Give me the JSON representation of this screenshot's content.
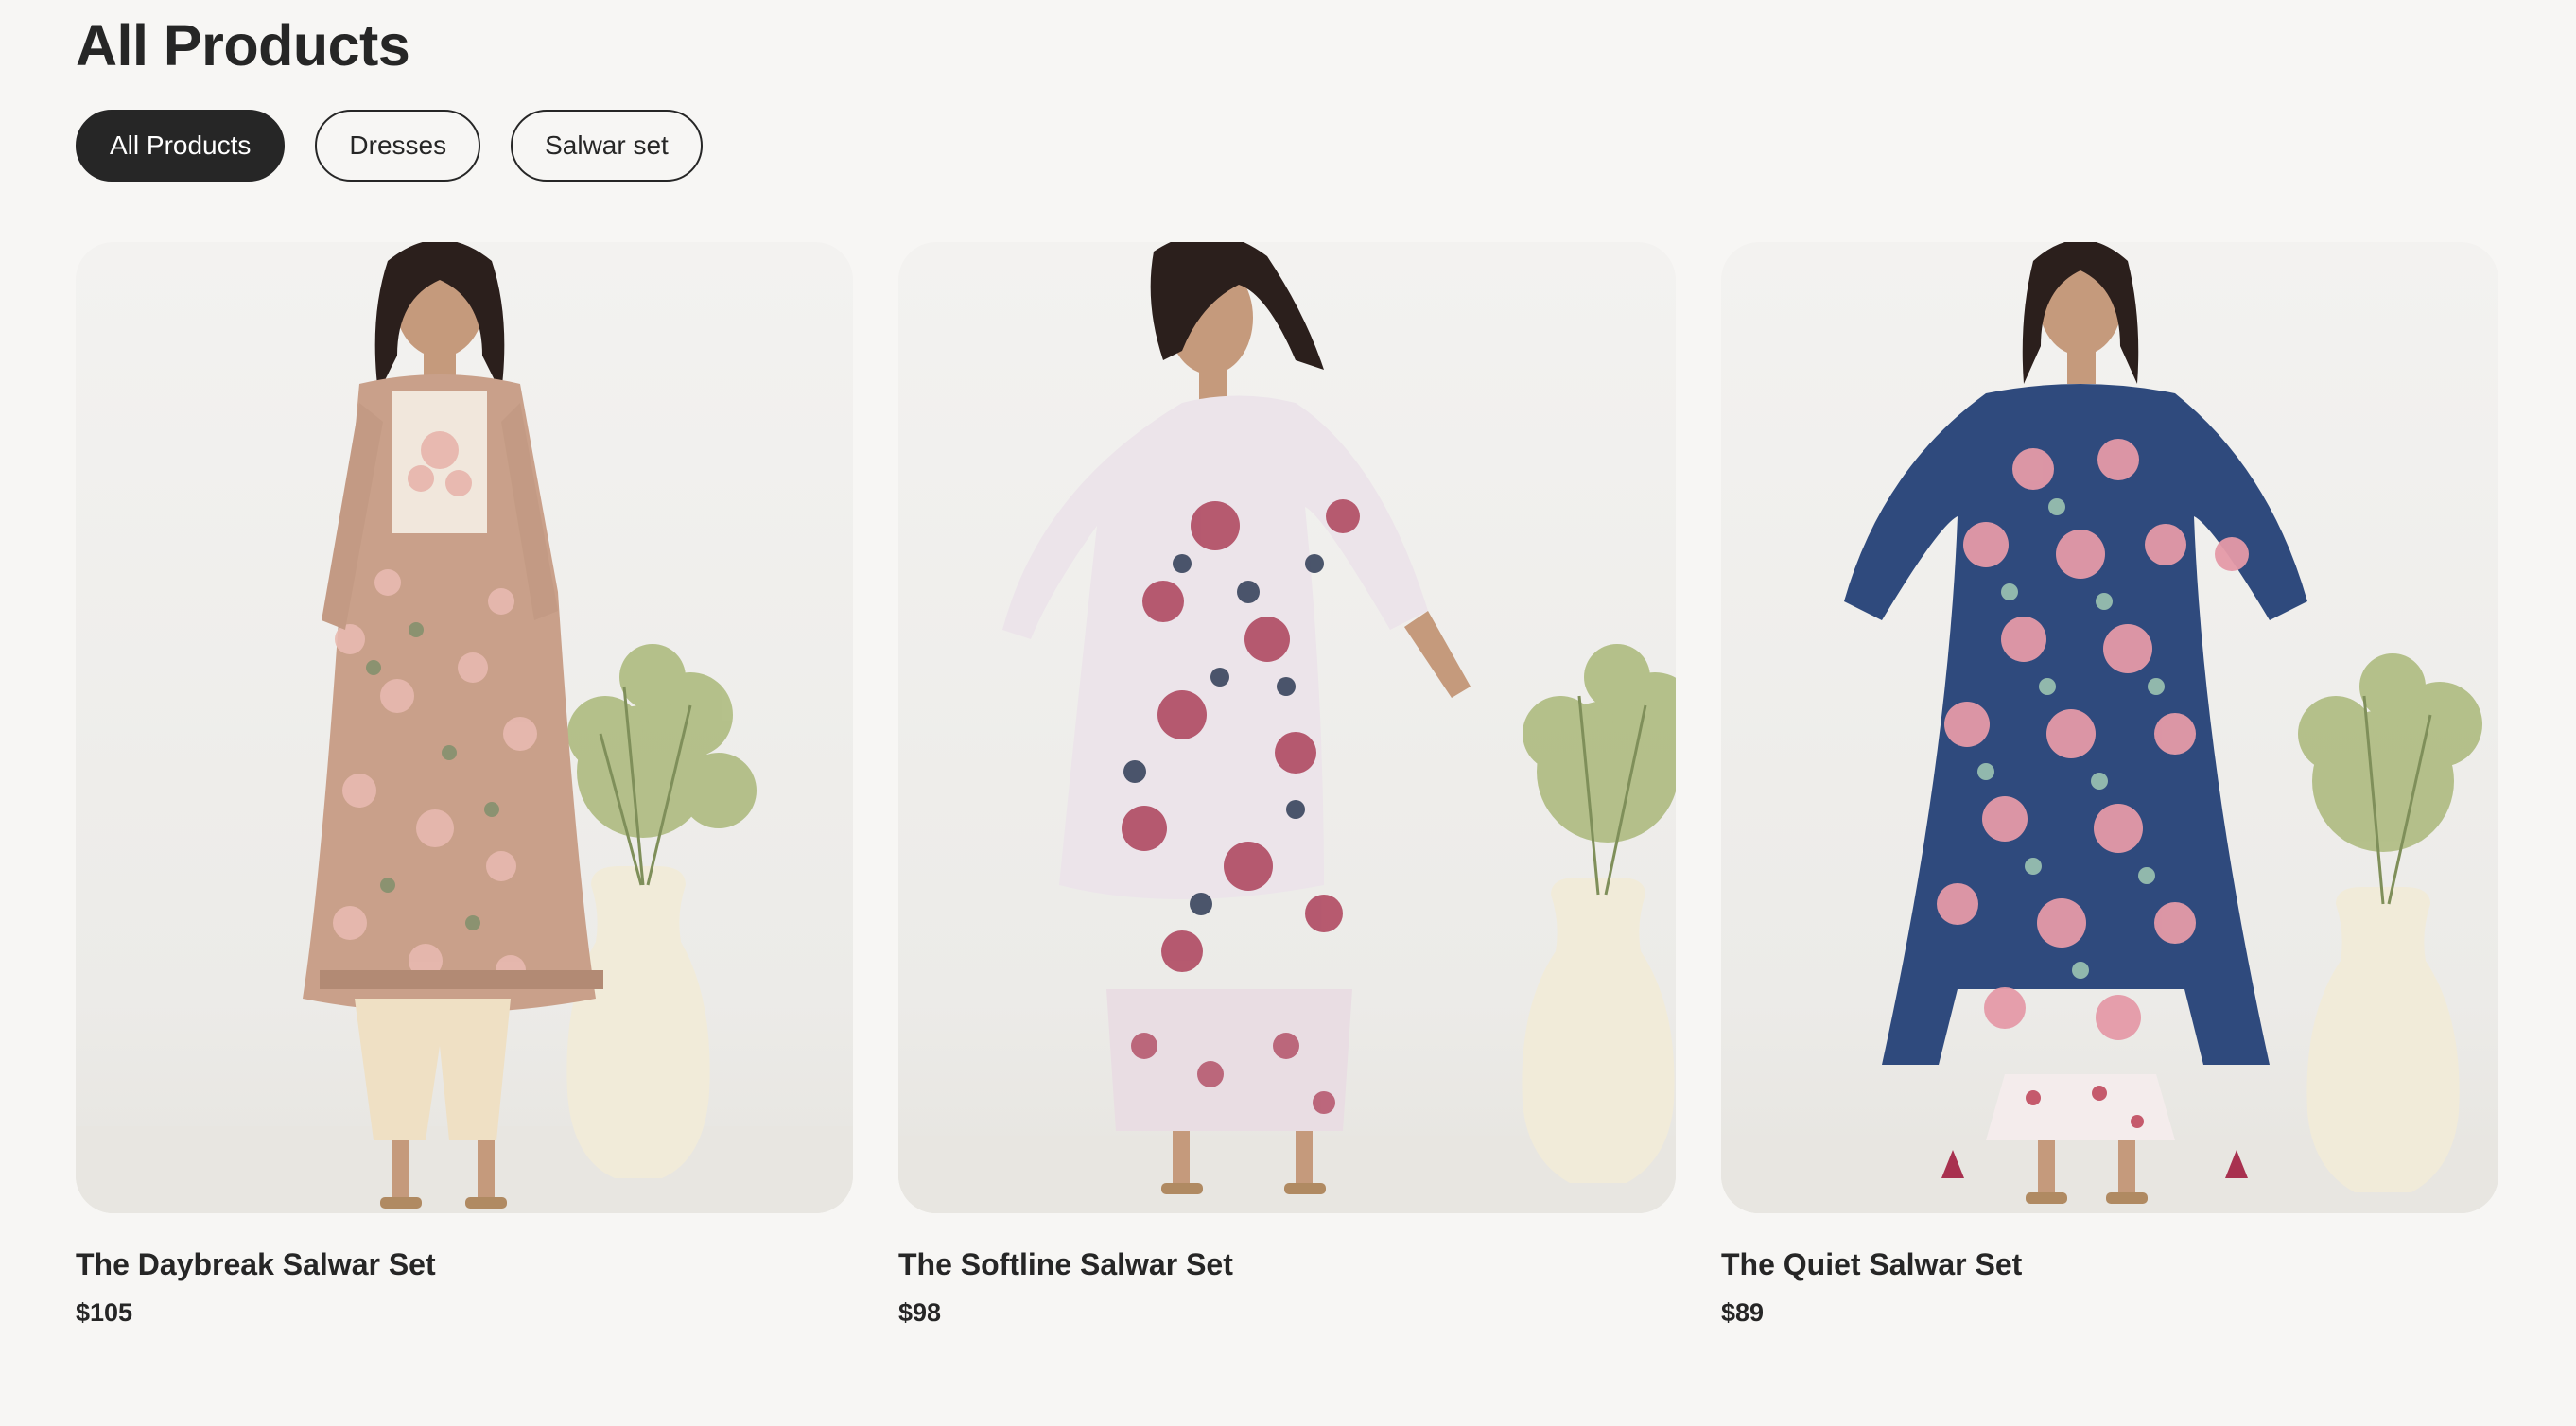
{
  "page": {
    "title": "All Products"
  },
  "filters": [
    {
      "label": "All Products",
      "active": true
    },
    {
      "label": "Dresses",
      "active": false
    },
    {
      "label": "Salwar set",
      "active": false
    }
  ],
  "products": [
    {
      "name": "The Daybreak Salwar Set",
      "price": "$105",
      "image": "photo-model-peach-floral-kurta",
      "colors": {
        "garment": "#c9a08a",
        "print": "#e8b9b0",
        "leaf": "#7c8f6a",
        "pants": "#efe0c4"
      }
    },
    {
      "name": "The Softline Salwar Set",
      "price": "$98",
      "image": "photo-model-white-kaftan-red-floral",
      "colors": {
        "garment": "#ece4ea",
        "print": "#b04a62",
        "leaf": "#2e3b55",
        "pants": "#e9dde3"
      }
    },
    {
      "name": "The Quiet Salwar Set",
      "price": "$89",
      "image": "photo-model-navy-kaftan-pink-roses",
      "colors": {
        "garment": "#2f4a7d",
        "print": "#e59aa8",
        "leaf": "#9cc4b2",
        "pants": "#f4ecec"
      }
    }
  ]
}
